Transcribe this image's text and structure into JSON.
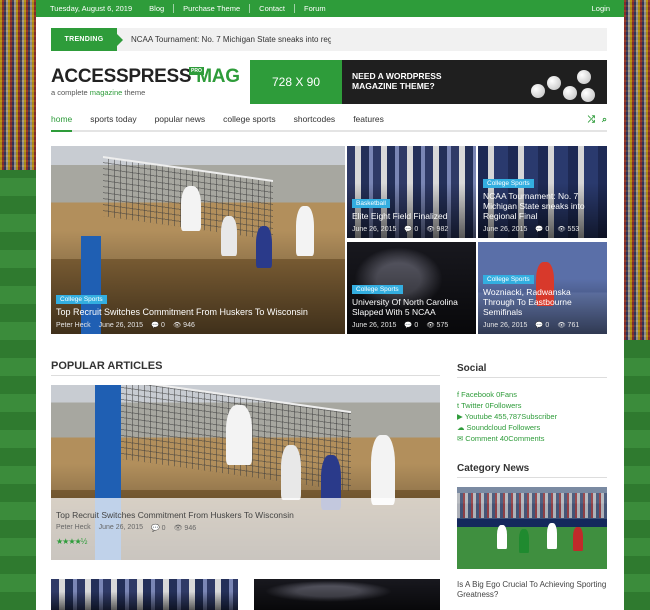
{
  "topbar": {
    "date": "Tuesday, August 6, 2019",
    "links": [
      "Blog",
      "Purchase Theme",
      "Contact",
      "Forum"
    ],
    "login": "Login"
  },
  "trending": {
    "label": "TRENDING",
    "text": "NCAA Tournament: No. 7 Michigan State sneaks into reg_"
  },
  "logo": {
    "name_part1": "ACCESSPRESS ",
    "name_part2": "MAG",
    "pro": "PRO",
    "tag_part1": "a complete ",
    "tag_part2": "magazine",
    "tag_part3": " theme"
  },
  "ad": {
    "size": "728 X 90",
    "line1": "NEED A WORDPRESS",
    "line2": "MAGAZINE THEME?"
  },
  "nav": {
    "items": [
      "home",
      "sports today",
      "popular news",
      "college sports",
      "shortcodes",
      "features"
    ],
    "active": "home",
    "icons": [
      "shuffle-icon",
      "search-icon"
    ]
  },
  "featured": [
    {
      "badge": "College Sports",
      "title": "Top Recruit Switches Commitment From Huskers To Wisconsin",
      "author": "Peter Heck",
      "date": "June 26, 2015",
      "comments": "0",
      "views": "946"
    },
    {
      "badge": "Basketball",
      "title": "Elite Eight Field Finalized",
      "date": "June 26, 2015",
      "comments": "0",
      "views": "982"
    },
    {
      "badge": "College Sports",
      "title": "NCAA Tournament: No. 7 Michigan State sneaks into Regional Final",
      "date": "June 26, 2015",
      "comments": "0",
      "views": "553"
    },
    {
      "badge": "College Sports",
      "title": "University Of North Carolina Slapped With 5 NCAA",
      "date": "June 26, 2015",
      "comments": "0",
      "views": "575"
    },
    {
      "badge": "College Sports",
      "title": "Wozniacki, Radwanska Through To Eastbourne Semifinals",
      "date": "June 26, 2015",
      "comments": "0",
      "views": "761"
    }
  ],
  "popular": {
    "heading": "POPULAR ARTICLES",
    "title": "Top Recruit Switches Commitment From Huskers To Wisconsin",
    "author": "Peter Heck",
    "date": "June 26, 2015",
    "comments": "0",
    "views": "946",
    "rating": 4.5,
    "stars": "★★★★½"
  },
  "sidebar": {
    "social_heading": "Social",
    "social": [
      {
        "icon": "facebook-icon",
        "glyph": "f",
        "text": "Facebook 0Fans"
      },
      {
        "icon": "twitter-icon",
        "glyph": "t",
        "text": "Twitter 0Followers"
      },
      {
        "icon": "youtube-icon",
        "glyph": "▶",
        "text": "Youtube 455,787Subscriber"
      },
      {
        "icon": "soundcloud-icon",
        "glyph": "☁",
        "text": "Soundcloud Followers"
      },
      {
        "icon": "comment-icon",
        "glyph": "✉",
        "text": "Comment 40Comments"
      }
    ],
    "category_heading": "Category News",
    "category_title": "Is A Big Ego Crucial To Achieving Sporting Greatness?"
  },
  "colors": {
    "accent": "#2e9c3a",
    "badge": "#33aee0"
  }
}
